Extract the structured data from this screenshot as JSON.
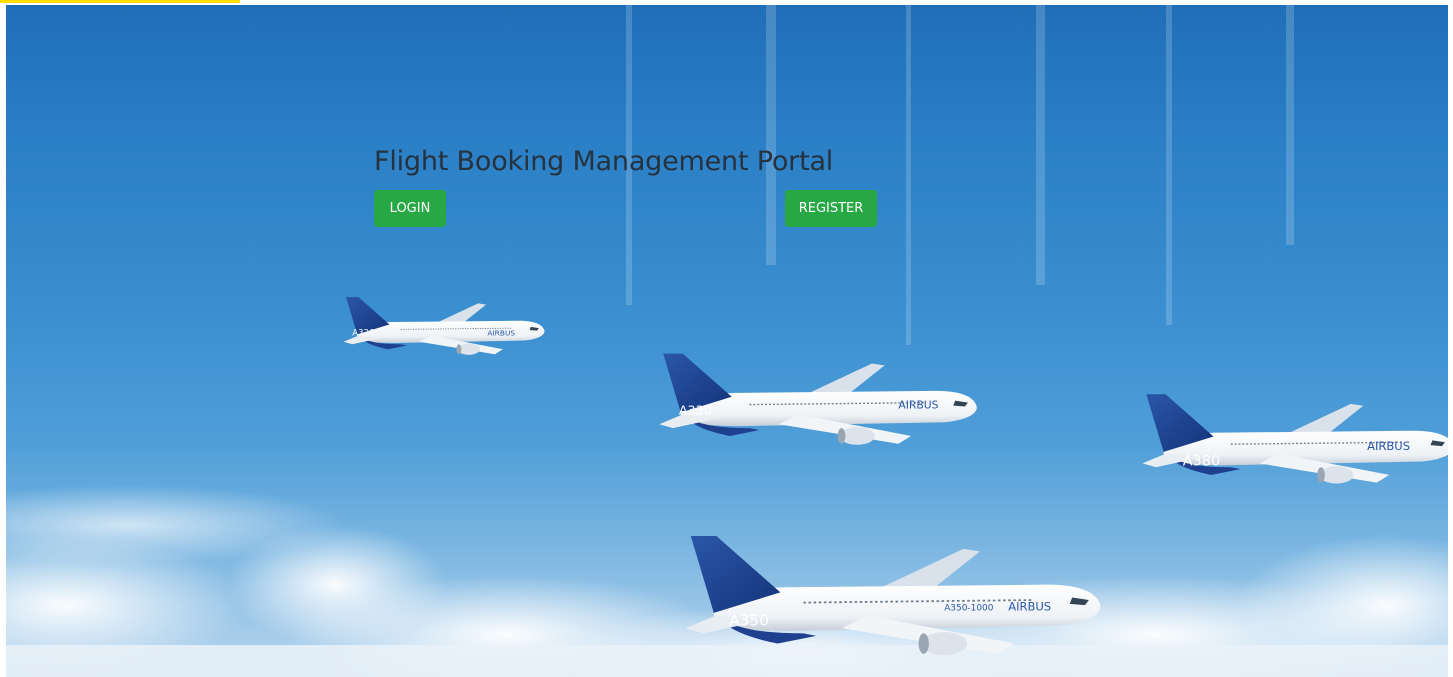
{
  "page": {
    "title": "Flight Booking Management Portal"
  },
  "actions": {
    "login_label": "LOGIN",
    "register_label": "REGISTER"
  },
  "aircraft": [
    {
      "label": "A320",
      "brand": "AIRBUS"
    },
    {
      "label": "A330",
      "brand": "AIRBUS"
    },
    {
      "label": "A380",
      "brand": "AIRBUS"
    },
    {
      "label": "A350",
      "model": "A350-1000",
      "brand": "AIRBUS"
    }
  ],
  "colors": {
    "button": "#28a745",
    "title": "#26323d",
    "sky": "#2a7fc6",
    "accent_strip": "#ffde00"
  }
}
